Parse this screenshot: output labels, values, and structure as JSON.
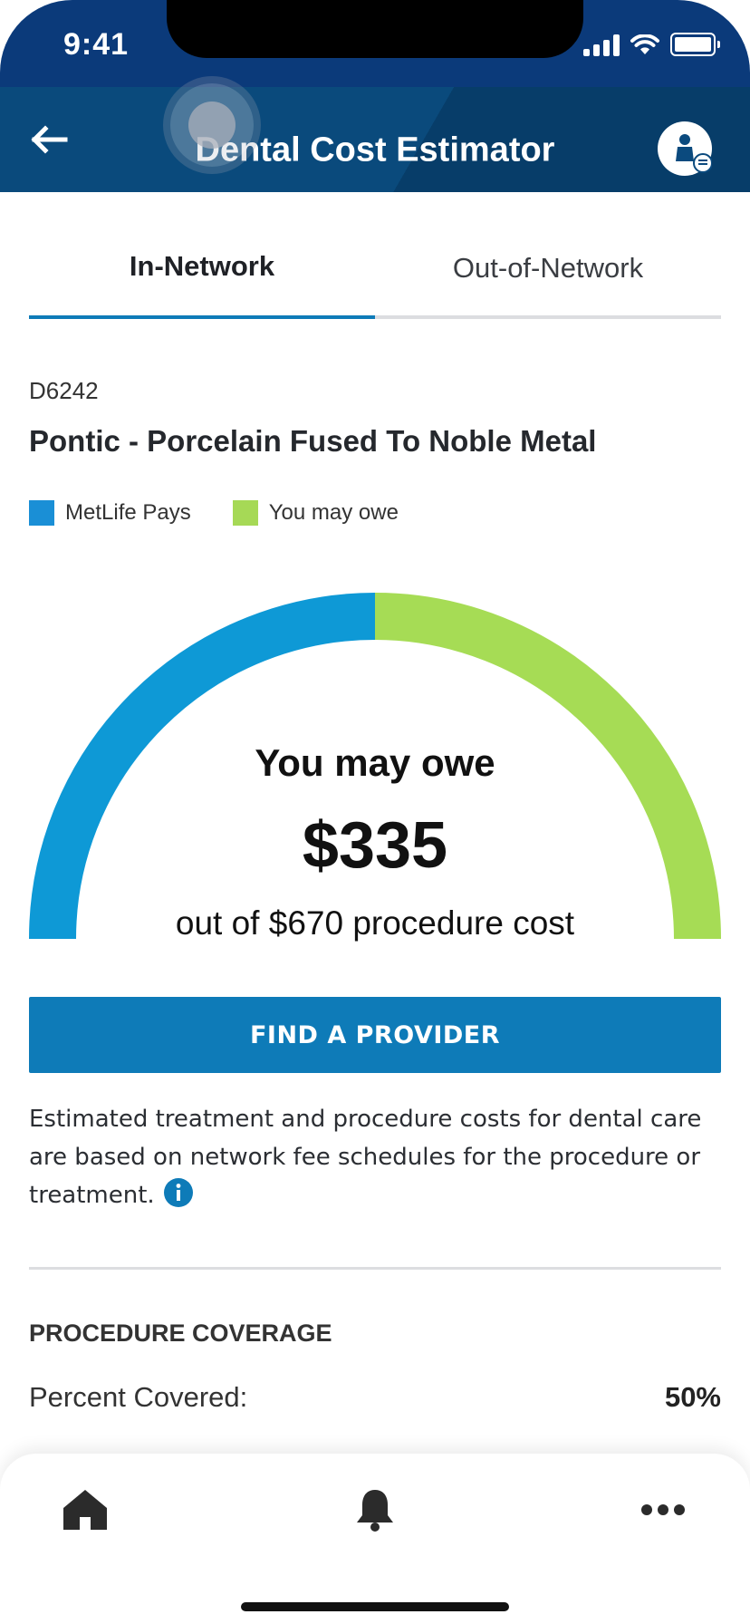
{
  "status_bar": {
    "time": "9:41"
  },
  "header": {
    "title": "Dental Cost Estimator"
  },
  "tabs": [
    {
      "label": "In-Network",
      "selected": true
    },
    {
      "label": "Out-of-Network",
      "selected": false
    }
  ],
  "procedure": {
    "code": "D6242",
    "name": "Pontic - Porcelain Fused To Noble Metal"
  },
  "legend": [
    {
      "label": "MetLife Pays",
      "color": "#1a8fd6"
    },
    {
      "label": "You may owe",
      "color": "#a6d956"
    }
  ],
  "gauge": {
    "owe_label": "You may owe",
    "owe_amount": "$335",
    "cost_line": "out of $670 procedure cost",
    "metlife_pays_fraction": 0.5,
    "you_owe_fraction": 0.5
  },
  "find_provider_label": "FIND A PROVIDER",
  "disclaimer": "Estimated treatment and procedure costs for dental care are based on network fee schedules for the procedure or treatment.",
  "coverage": {
    "title": "PROCEDURE COVERAGE",
    "percent_label": "Percent Covered:",
    "percent_value": "50%"
  },
  "bottom_nav": [
    {
      "icon": "home-icon"
    },
    {
      "icon": "bell-icon"
    },
    {
      "icon": "more-icon"
    }
  ],
  "colors": {
    "header_bg": "#0a4a7c",
    "accent": "#0e7bb8",
    "metlife_blue": "#0e99d6",
    "owe_green": "#a6dc55"
  }
}
